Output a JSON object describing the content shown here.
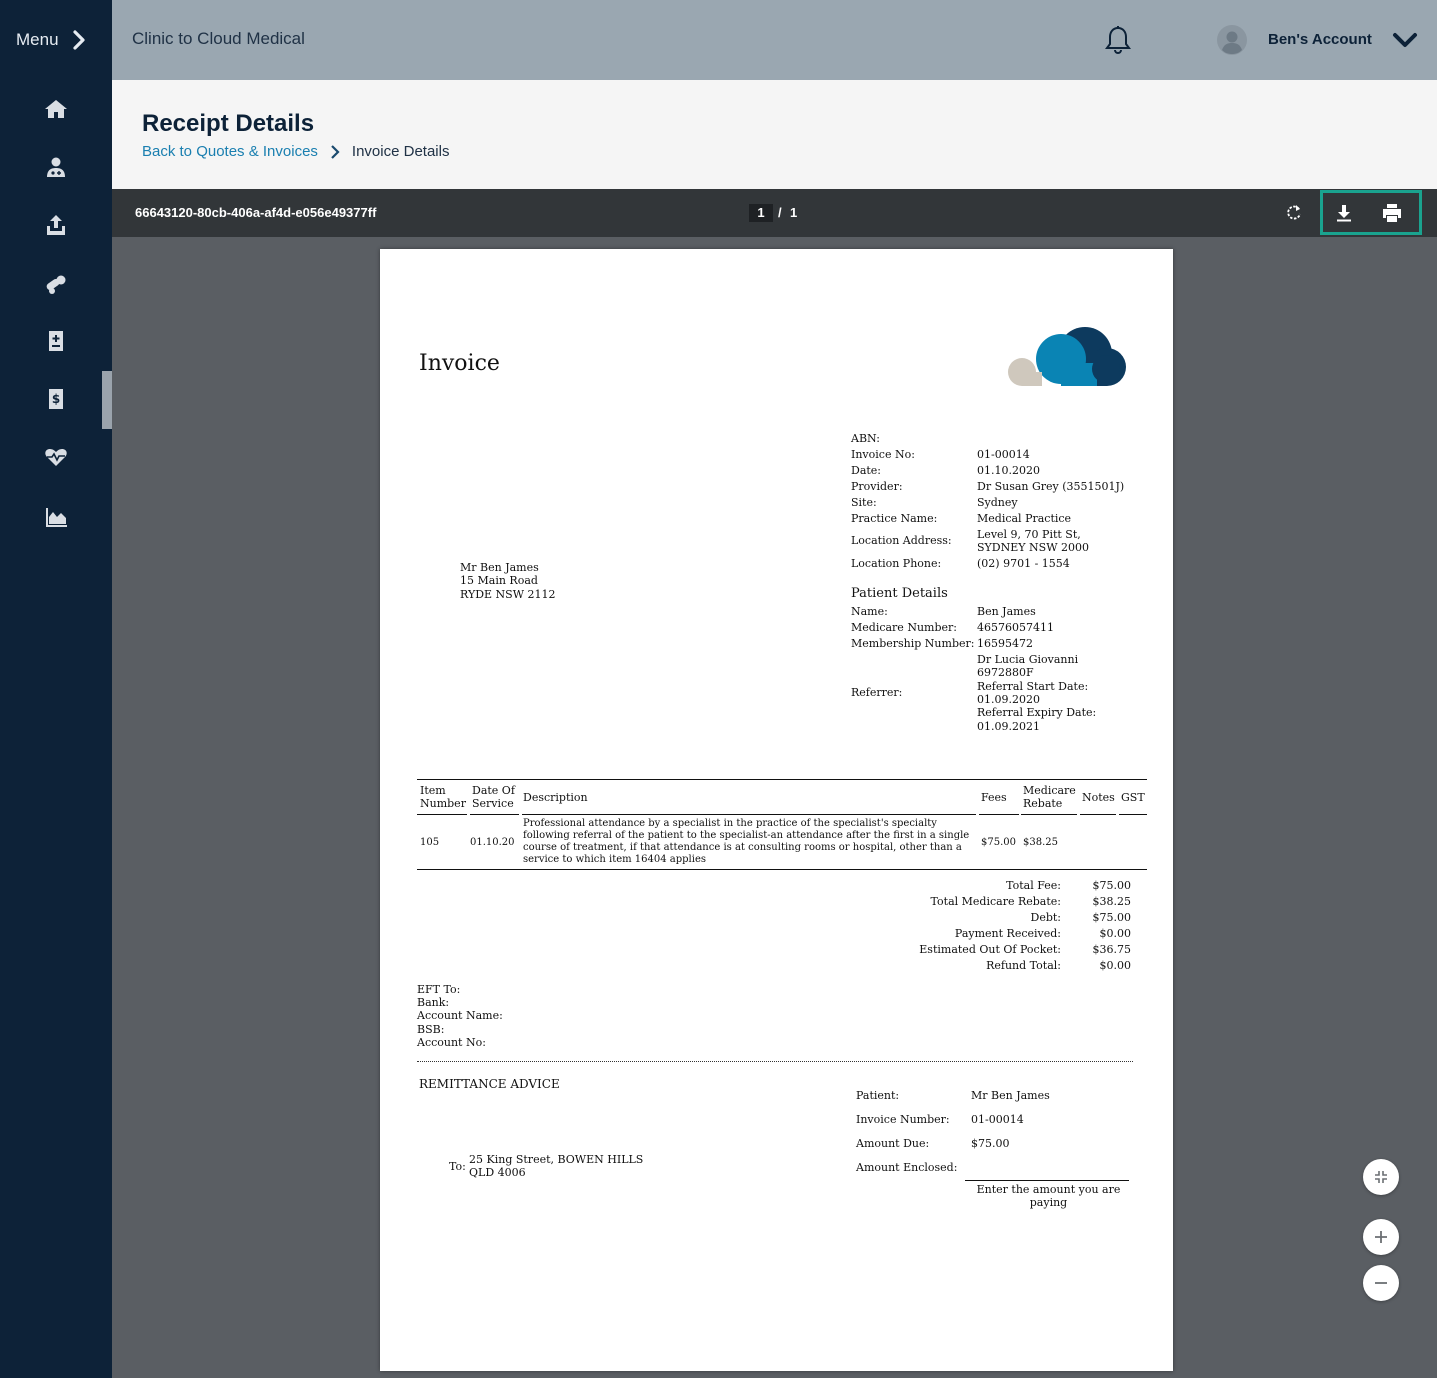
{
  "sidebar": {
    "menu_label": "Menu",
    "items": [
      {
        "icon": "home-icon"
      },
      {
        "icon": "doctor-icon"
      },
      {
        "icon": "upload-icon"
      },
      {
        "icon": "pills-icon"
      },
      {
        "icon": "medical-record-icon"
      },
      {
        "icon": "invoice-dollar-icon",
        "active": true
      },
      {
        "icon": "heartbeat-icon"
      },
      {
        "icon": "area-chart-icon"
      }
    ]
  },
  "header": {
    "app_title": "Clinic to Cloud Medical",
    "account_label": "Ben's Account"
  },
  "page": {
    "title": "Receipt Details",
    "breadcrumb_back": "Back to Quotes & Invoices",
    "breadcrumb_current": "Invoice Details"
  },
  "viewer": {
    "document_id": "66643120-80cb-406a-af4d-e056e49377ff",
    "current_page": "1",
    "page_separator": "/",
    "total_pages": "1",
    "highlight_color": "#1aa38f"
  },
  "invoice": {
    "heading": "Invoice",
    "details": [
      {
        "label": "ABN:",
        "value": ""
      },
      {
        "label": "Invoice No:",
        "value": "01-00014"
      },
      {
        "label": "Date:",
        "value": "01.10.2020"
      },
      {
        "label": "Provider:",
        "value": "Dr Susan Grey (3551501J)"
      },
      {
        "label": "Site:",
        "value": "Sydney"
      },
      {
        "label": "Practice Name:",
        "value": "Medical Practice"
      },
      {
        "label": "Location Address:",
        "value_line1": "Level 9,  70 Pitt St,",
        "value_line2": "SYDNEY NSW 2000"
      },
      {
        "label": "Location Phone:",
        "value": "(02) 9701 - 1554"
      }
    ],
    "address": [
      "Mr Ben James",
      "15 Main Road",
      "RYDE NSW 2112"
    ],
    "patient_heading": "Patient Details",
    "patient": {
      "name_label": "Name:",
      "name": "Ben James",
      "medicare_label": "Medicare Number:",
      "medicare": "46576057411",
      "membership_label": "Membership Number:",
      "membership": "16595472",
      "referrer_label": "Referrer:",
      "referrer_lines": [
        "Dr Lucia Giovanni",
        "6972880F",
        "Referral Start Date:",
        "01.09.2020",
        "Referral Expiry Date:",
        "01.09.2021"
      ]
    },
    "table": {
      "headers": {
        "item": [
          "Item",
          "Number"
        ],
        "date": [
          "Date Of",
          "Service"
        ],
        "description": "Description",
        "fees": "Fees",
        "rebate": [
          "Medicare",
          "Rebate"
        ],
        "notes": "Notes",
        "gst": "GST"
      },
      "row": {
        "item": "105",
        "date": "01.10.20",
        "description_lines": [
          "Professional attendance by a specialist in the practice of the specialist's specialty",
          "following referral of the patient to the specialist-an attendance after the first in a single",
          "course of treatment, if that attendance is at consulting rooms or hospital, other than a",
          "service to which item 16404 applies"
        ],
        "fees": "$75.00",
        "rebate": "$38.25"
      }
    },
    "totals": [
      {
        "label": "Total Fee:",
        "value": "$75.00"
      },
      {
        "label": "Total Medicare Rebate:",
        "value": "$38.25"
      },
      {
        "label": "Debt:",
        "value": "$75.00"
      },
      {
        "label": "Payment Received:",
        "value": "$0.00"
      },
      {
        "label": "Estimated Out Of Pocket:",
        "value": "$36.75"
      },
      {
        "label": "Refund Total:",
        "value": "$0.00"
      }
    ],
    "eft": [
      "EFT To:",
      "Bank:",
      "Account Name:",
      "BSB:",
      "Account No:"
    ],
    "remittance": {
      "heading": "REMITTANCE ADVICE",
      "to_label": "To:",
      "to_lines": [
        "25 King Street, BOWEN HILLS",
        "QLD 4006"
      ],
      "patient_label": "Patient:",
      "patient": "Mr Ben James",
      "invoice_label": "Invoice Number:",
      "invoice": "01-00014",
      "due_label": "Amount Due:",
      "due": "$75.00",
      "enclosed_label": "Amount Enclosed:",
      "hint_line1": "Enter the amount you are",
      "hint_line2": "paying"
    }
  },
  "colors": {
    "sidebar_bg": "#0d2238",
    "topbar_bg": "#9aa7b1",
    "link": "#1a7fb0",
    "logo_dark": "#0d3a5e",
    "logo_mid": "#0a84b4",
    "logo_light": "#cfc8bd"
  }
}
